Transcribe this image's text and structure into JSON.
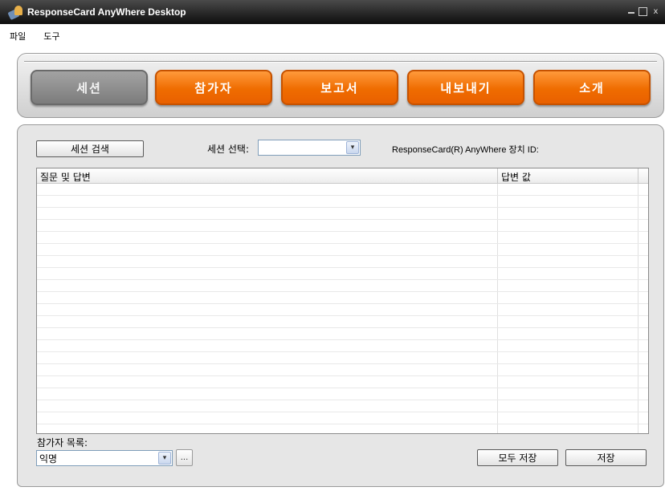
{
  "window": {
    "title": "ResponseCard AnyWhere Desktop",
    "icon": "app-icon",
    "controls": {
      "minimize": "–",
      "maximize": "□",
      "close": "x"
    }
  },
  "menu": {
    "items": [
      "파일",
      "도구"
    ]
  },
  "nav": {
    "tabs": [
      {
        "label": "세션",
        "active": true
      },
      {
        "label": "참가자",
        "active": false
      },
      {
        "label": "보고서",
        "active": false
      },
      {
        "label": "내보내기",
        "active": false
      },
      {
        "label": "소개",
        "active": false
      }
    ],
    "active_color": "#8f8f8f",
    "accent_color": "#f07400"
  },
  "session": {
    "search_button": "세션 검색",
    "select_label": "세션 선택:",
    "select_value": "",
    "device_id_label": "ResponseCard(R) AnyWhere 장치 ID:"
  },
  "table": {
    "columns": [
      "질문 및 답변",
      "답변 값"
    ],
    "rows": []
  },
  "participants": {
    "label": "참가자 목록:",
    "selected": "익명",
    "browse_button": "..."
  },
  "actions": {
    "save_all": "모두 저장",
    "save": "저장"
  }
}
